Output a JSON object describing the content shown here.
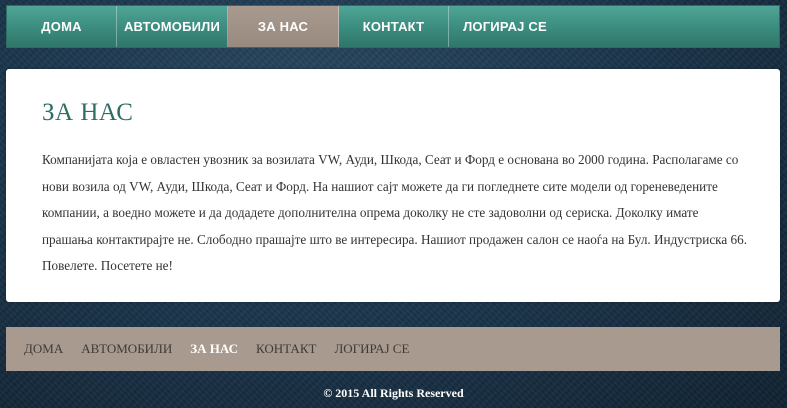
{
  "top_nav": {
    "items": [
      {
        "label": "ДОМА",
        "active": false
      },
      {
        "label": "АВТОМОБИЛИ",
        "active": false
      },
      {
        "label": "ЗА НАС",
        "active": true
      },
      {
        "label": "КОНТАКТ",
        "active": false
      },
      {
        "label": "ЛОГИРАЈ СЕ",
        "active": false
      }
    ]
  },
  "main": {
    "title": "ЗА НАС",
    "body": "Компанијата која е овластен увозник за возилата VW, Ауди, Шкода, Сеат и Форд е основана во 2000 година. Располагаме со нови возила од VW, Ауди, Шкода, Сеат и Форд. На нашиот сајт можете да ги погледнете сите модели од гореневедените компании, а воедно можете и да додадете дополнителна опрема доколку не сте задоволни од сериска. Доколку имате прашања контактирајте не. Слободно прашајте што ве интересира. Нашиот продажен салон се наоѓа на Бул. Индустриска 66. Повелете. Посетете не!"
  },
  "bottom_nav": {
    "items": [
      {
        "label": "ДОМА",
        "active": false
      },
      {
        "label": "АВТОМОБИЛИ",
        "active": false
      },
      {
        "label": "ЗА НАС",
        "active": true
      },
      {
        "label": "КОНТАКТ",
        "active": false
      },
      {
        "label": "ЛОГИРАЈ СЕ",
        "active": false
      }
    ]
  },
  "footer": {
    "text": "© 2015 All Rights Reserved"
  },
  "colors": {
    "nav_teal": "#3a8c7e",
    "active_taupe": "#a89a8f",
    "heading": "#2f6f63"
  }
}
